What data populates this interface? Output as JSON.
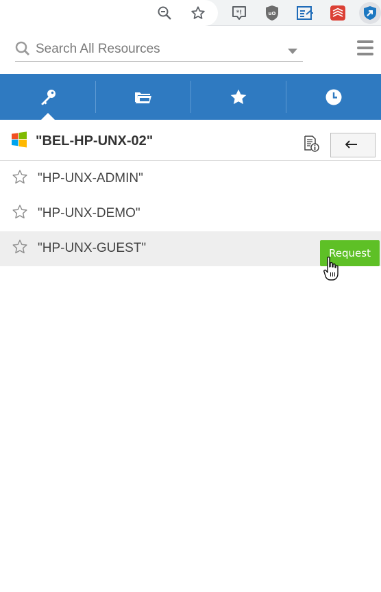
{
  "browser_toolbar": {
    "icons": [
      "zoom-out-icon",
      "bookmark-star-icon",
      "feedback-extension-icon",
      "ublock-origin-icon",
      "share-extension-icon",
      "todoist-icon",
      "password-manager-icon"
    ]
  },
  "search": {
    "placeholder": "Search All Resources",
    "value": ""
  },
  "tabs": [
    {
      "name": "tab-resources",
      "icon": "key-icon",
      "active": true
    },
    {
      "name": "tab-groups",
      "icon": "folders-icon",
      "active": false
    },
    {
      "name": "tab-favorites",
      "icon": "star-icon",
      "active": false
    },
    {
      "name": "tab-recent",
      "icon": "clock-icon",
      "active": false
    }
  ],
  "resource": {
    "title": "\"BEL-HP-UNX-02\"",
    "os_icon": "windows-logo-icon"
  },
  "accounts": [
    {
      "name": "\"HP-UNX-ADMIN\"",
      "favorite": false
    },
    {
      "name": "\"HP-UNX-DEMO\"",
      "favorite": false
    },
    {
      "name": "\"HP-UNX-GUEST\"",
      "favorite": false,
      "action_label": "Request"
    }
  ],
  "colors": {
    "tabbar": "#2f7ac1",
    "request_button": "#5ec026",
    "row_hover": "#eeeeee"
  }
}
